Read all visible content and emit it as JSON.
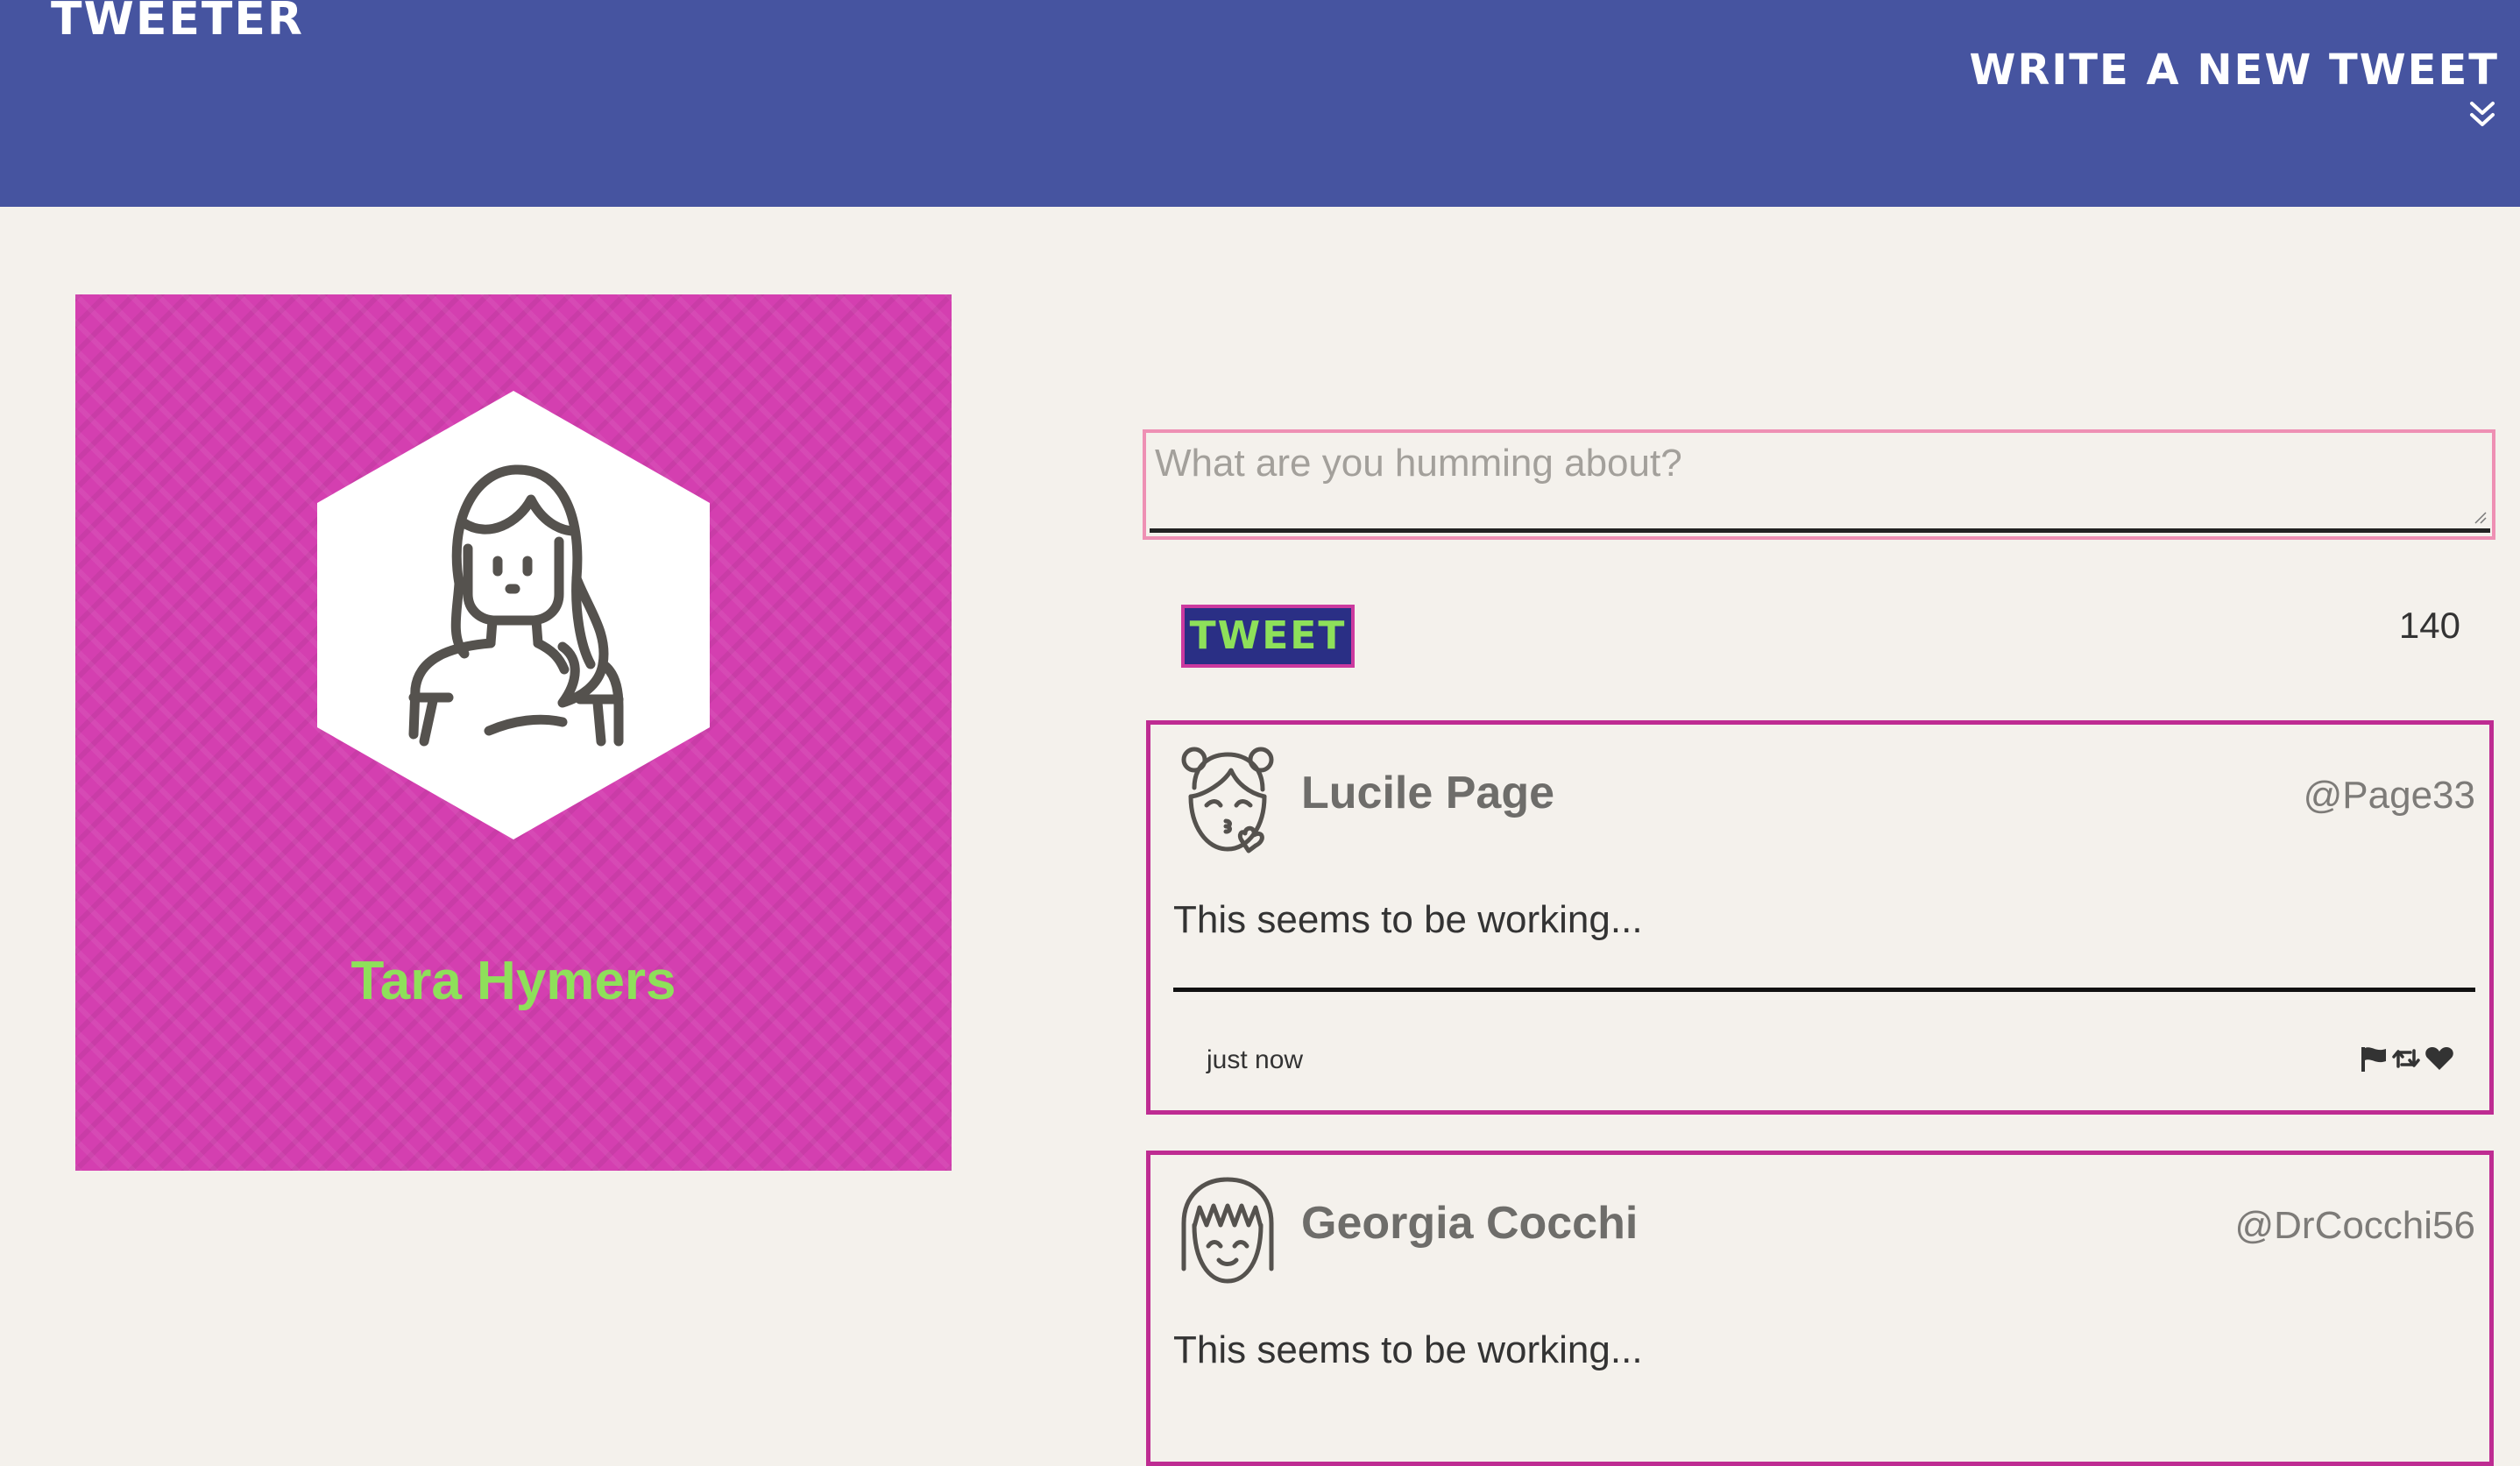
{
  "header": {
    "brand": "TWEETER",
    "compose_label": "WRITE A NEW TWEET",
    "compose_icon": "double-chevron-down-icon"
  },
  "profile": {
    "name": "Tara Hymers",
    "avatar_icon": "woman-avatar-icon",
    "background_color": "#d43fb0",
    "name_color": "#8ee05a"
  },
  "composer": {
    "placeholder": "What are you humming about?",
    "value": "",
    "submit_label": "TWEET",
    "char_counter": "140"
  },
  "tweets": [
    {
      "name": "Lucile Page",
      "handle": "@Page33",
      "body": "This seems to be working...",
      "time": "just now",
      "avatar_icon": "girl-kiss-avatar-icon",
      "actions": [
        "flag-icon",
        "retweet-icon",
        "heart-icon"
      ]
    },
    {
      "name": "Georgia Cocchi",
      "handle": "@DrCocchi56",
      "body": "This seems to be working...",
      "avatar_icon": "girl-bangs-avatar-icon"
    }
  ],
  "colors": {
    "nav": "#4654a0",
    "page_bg": "#f4f1ec",
    "accent_magenta": "#be2c92",
    "accent_green": "#8ee05a",
    "button_bg": "#2a2f85"
  }
}
